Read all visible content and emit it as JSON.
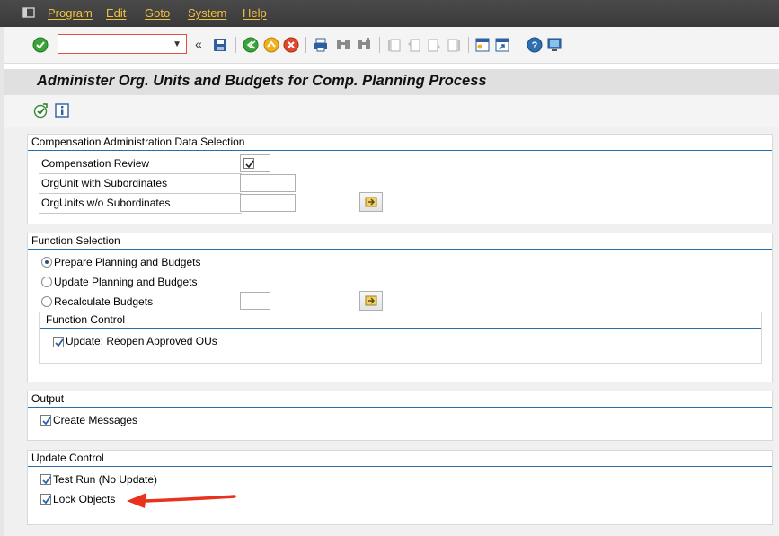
{
  "menu": {
    "items": [
      "Program",
      "Edit",
      "Goto",
      "System",
      "Help"
    ]
  },
  "toolbar": {
    "command_value": "",
    "icons": [
      "enter-icon",
      "save-icon",
      "back-icon",
      "exit-icon",
      "cancel-icon",
      "print-icon",
      "find-icon",
      "find-next-icon",
      "first-page-icon",
      "previous-page-icon",
      "next-page-icon",
      "last-page-icon",
      "create-session-icon",
      "shortcut-icon",
      "help-icon",
      "layout-icon"
    ]
  },
  "title": "Administer Org. Units and Budgets for Comp. Planning Process",
  "app_toolbar": {
    "icons": [
      "execute-icon",
      "info-icon"
    ]
  },
  "groups": {
    "selection": {
      "title": "Compensation Administration Data Selection",
      "compensation_review_label": "Compensation Review",
      "orgunit_with_sub_label": "OrgUnit with Subordinates",
      "orgunit_without_sub_label": "OrgUnits w/o Subordinates",
      "compensation_review_checked": true
    },
    "function": {
      "title": "Function Selection",
      "prepare_label": "Prepare Planning and Budgets",
      "update_label": "Update Planning and Budgets",
      "recalc_label": "Recalculate Budgets",
      "selected": "prepare",
      "control": {
        "title": "Function Control",
        "update_label": "Update:  Reopen Approved OUs",
        "update_checked": true
      }
    },
    "output": {
      "title": "Output",
      "create_messages_label": "Create Messages",
      "create_messages_checked": true
    },
    "update_control": {
      "title": "Update Control",
      "test_run_label": "Test Run (No Update)",
      "test_run_checked": true,
      "lock_objects_label": "Lock Objects",
      "lock_objects_checked": true
    }
  },
  "colors": {
    "menu_text": "#f0c040",
    "group_line": "#2e6ea6",
    "annotation_arrow": "#e8321e"
  }
}
